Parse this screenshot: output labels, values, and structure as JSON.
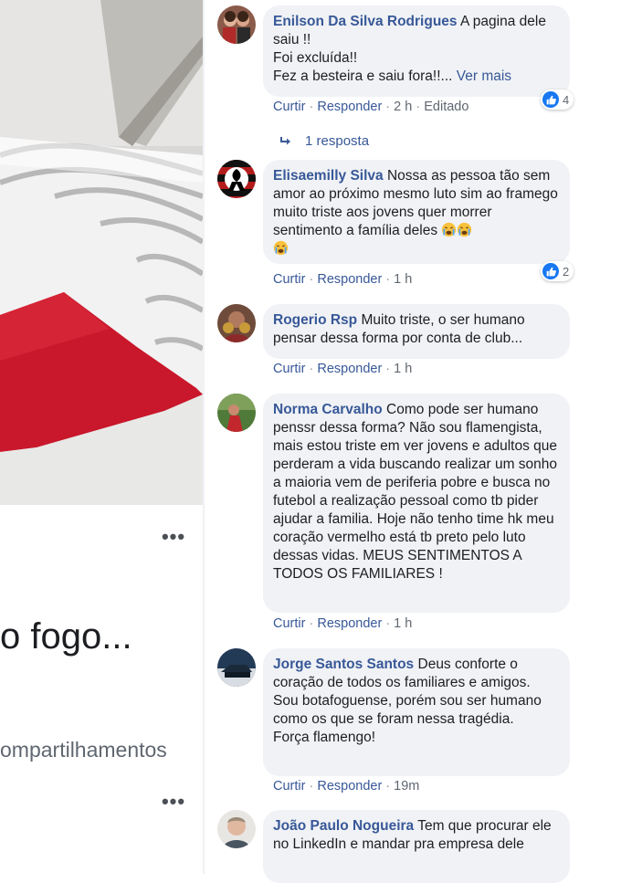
{
  "post": {
    "text": "o fogo...",
    "shares": "ompartilhamentos",
    "more_icon": "more-horizontal-icon"
  },
  "comments": [
    {
      "author": "Enilson Da Silva Rodrigues",
      "text_first": "A pagina dele",
      "text_rest": "saiu !!\nFoi excluída!!\nFez a besteira e saiu fora!!...",
      "see_more": "Ver mais",
      "actions": {
        "like": "Curtir",
        "reply": "Responder",
        "time": "2 h",
        "edited": "Editado"
      },
      "reactions": "4",
      "replies": "1 resposta"
    },
    {
      "author": "Elisaemilly Silva",
      "text": "Nossa as pessoa tão sem amor ao próximo mesmo luto sim ao framego muito triste aos jovens quer morrer sentimento a família deles",
      "emoji": "crying-face-icon",
      "actions": {
        "like": "Curtir",
        "reply": "Responder",
        "time": "1 h"
      },
      "reactions": "2"
    },
    {
      "author": "Rogerio Rsp",
      "text": "Muito triste, o ser humano pensar dessa forma por conta de club...",
      "actions": {
        "like": "Curtir",
        "reply": "Responder",
        "time": "1 h"
      }
    },
    {
      "author": "Norma Carvalho",
      "text": "Como pode ser humano penssr dessa forma? Não sou flamengista, mais estou triste em ver jovens e adultos que perderam a vida buscando realizar um sonho a maioria vem de periferia pobre e busca no futebol a realização pessoal como tb pider ajudar a familia. Hoje não tenho time hk meu coração vermelho está tb preto pelo luto dessas vidas. MEUS SENTIMENTOS A TODOS OS FAMILIARES !",
      "actions": {
        "like": "Curtir",
        "reply": "Responder",
        "time": "1 h"
      }
    },
    {
      "author": "Jorge Santos Santos",
      "text": "Deus conforte o coração de todos os familiares e amigos. Sou botafoguense, porém sou ser humano como os que se foram nessa tragédia.\nForça flamengo!",
      "actions": {
        "like": "Curtir",
        "reply": "Responder",
        "time": "19m"
      }
    },
    {
      "author": "João Paulo Nogueira",
      "text": "Tem que procurar ele no LinkedIn e mandar pra empresa dele"
    }
  ],
  "colors": {
    "author": "#385898",
    "bubble": "#f0f2f5",
    "like": "#1877f2",
    "meta": "#90949c"
  }
}
